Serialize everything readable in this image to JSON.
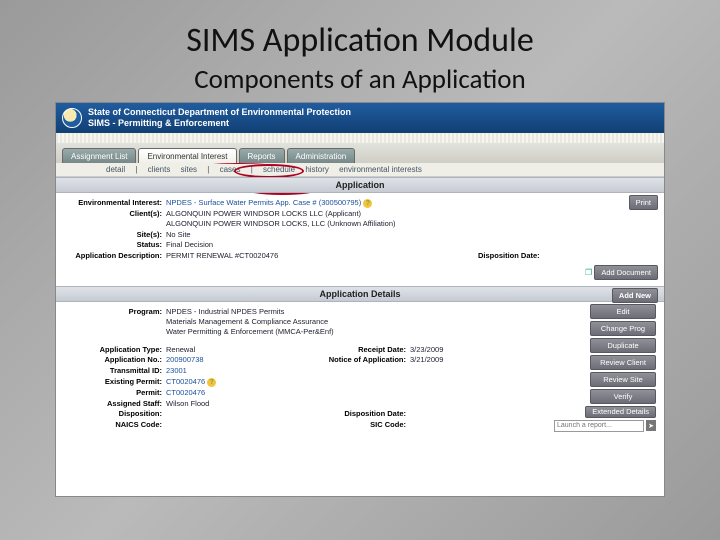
{
  "slide": {
    "title": "SIMS Application Module",
    "subtitle": "Components of an Application"
  },
  "banner": {
    "line1": "State of Connecticut Department of Environmental Protection",
    "line2": "SIMS - Permitting & Enforcement"
  },
  "tabs": {
    "items": [
      {
        "label": "Assignment List"
      },
      {
        "label": "Environmental Interest"
      },
      {
        "label": "Reports"
      },
      {
        "label": "Administration"
      }
    ]
  },
  "subtabs": {
    "items": [
      "detail",
      "|",
      "clients",
      "sites",
      "|",
      "cases",
      "|",
      "schedule",
      "history",
      "environmental interests"
    ]
  },
  "section1": {
    "title": "Application",
    "print_btn": "Print",
    "env_interest_label": "Environmental Interest:",
    "env_interest_value": "NPDES - Surface Water Permits App. Case # (300500795)",
    "clients_label": "Client(s):",
    "clients_value1": "ALGONQUIN POWER WINDSOR LOCKS LLC (Applicant)",
    "clients_value2": "ALGONQUIN POWER WINDSOR LOCKS, LLC (Unknown Affiliation)",
    "sites_label": "Site(s):",
    "sites_value": "No Site",
    "status_label": "Status:",
    "status_value": "Final Decision",
    "appdesc_label": "Application Description:",
    "appdesc_value": "PERMIT RENEWAL #CT0020476",
    "dispdate_label": "Disposition Date:",
    "dispdate_value": "",
    "add_doc_btn": "Add Document"
  },
  "section2": {
    "title": "Application Details",
    "addnew_btn": "Add New",
    "btns": {
      "edit": "Edit",
      "change_prog": "Change Prog",
      "duplicate": "Duplicate",
      "review_client": "Review Client",
      "review_site": "Review Site",
      "verify": "Verify",
      "extended": "Extended Details"
    },
    "report_placeholder": "Launch a report...",
    "program_label": "Program:",
    "program_value1": "NPDES - Industrial NPDES Permits",
    "program_value2": "Materials Management & Compliance Assurance",
    "program_value3": "Water Permitting & Enforcement (MMCA-Per&Enf)",
    "apptype_label": "Application Type:",
    "apptype_value": "Renewal",
    "receipt_label": "Receipt Date:",
    "receipt_value": "3/23/2009",
    "appno_label": "Application No.:",
    "appno_value": "200900738",
    "notice_label": "Notice of Application:",
    "notice_value": "3/21/2009",
    "transmittal_label": "Transmittal ID:",
    "transmittal_value": "23001",
    "existing_label": "Existing Permit:",
    "existing_value": "CT0020476",
    "permit_label": "Permit:",
    "permit_value": "CT0020476",
    "staff_label": "Assigned Staff:",
    "staff_value": "Wilson Flood",
    "disposition_label": "Disposition:",
    "dispdate_label": "Disposition Date:",
    "naics_label": "NAICS Code:",
    "sic_label": "SIC Code:"
  }
}
